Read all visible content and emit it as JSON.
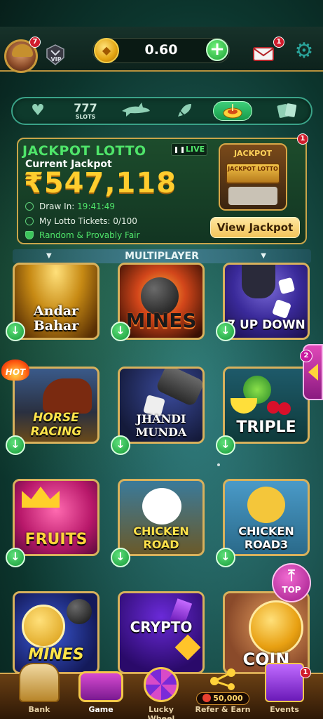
{
  "header": {
    "avatar_badge": "7",
    "vip_label": "VIP",
    "balance": "0.60",
    "mail_badge": "1"
  },
  "tabs": [
    {
      "label": "",
      "icon": "heart-icon"
    },
    {
      "label": "SLOTS",
      "icon": "slots-777-icon",
      "glyph": "777"
    },
    {
      "label": "",
      "icon": "shark-icon"
    },
    {
      "label": "",
      "icon": "rocket-icon"
    },
    {
      "label": "",
      "icon": "roulette-icon",
      "active": true
    },
    {
      "label": "",
      "icon": "cards-icon"
    }
  ],
  "jackpot": {
    "title": "JACKPOT LOTTO",
    "live": "LIVE",
    "subtitle": "Current Jackpot",
    "amount": "₹547,118",
    "draw_label": "Draw In:",
    "draw_time": "19:41:49",
    "tickets_label": "My Lotto Tickets:",
    "tickets_value": "0/100",
    "fair_label": "Random & Provably Fair",
    "machine_top": "JACKPOT",
    "machine_screen": "JACKPOT LOTTO",
    "view_button": "View Jackpot",
    "badge": "1"
  },
  "section": {
    "title": "MULTIPLAYER"
  },
  "games": [
    {
      "title": "Andar\nBahar",
      "t1": "Andar",
      "t2": "Bahar"
    },
    {
      "title": "MINES"
    },
    {
      "title": "7 UP DOWN"
    },
    {
      "title": "HORSE\nRACING",
      "t1": "HORSE",
      "t2": "RACING",
      "hot": "HOT"
    },
    {
      "title": "JHANDI\nMUNDA",
      "t1": "JHANDI",
      "t2": "MUNDA"
    },
    {
      "title": "TRIPLE"
    },
    {
      "title": "FRUITS"
    },
    {
      "title": "CHICKEN\nROAD",
      "t1": "CHICKEN",
      "t2": "ROAD"
    },
    {
      "title": "CHICKEN\nROAD3",
      "t1": "CHICKEN",
      "t2": "ROAD3"
    },
    {
      "title": "MINES"
    },
    {
      "title": "CRYPTO"
    },
    {
      "title": "COIN"
    }
  ],
  "side_tab": {
    "badge": "2"
  },
  "top_button": {
    "label": "TOP"
  },
  "bottom_nav": [
    {
      "label": "Bank"
    },
    {
      "label": "Game"
    },
    {
      "label": "Lucky Wheel"
    },
    {
      "label": "Refer & Earn",
      "pill": "50,000"
    },
    {
      "label": "Events",
      "badge": "1"
    }
  ],
  "colors": {
    "accent_green": "#4fe56a",
    "gold": "#ffcd2e",
    "frame_gold": "#d8b15c"
  }
}
